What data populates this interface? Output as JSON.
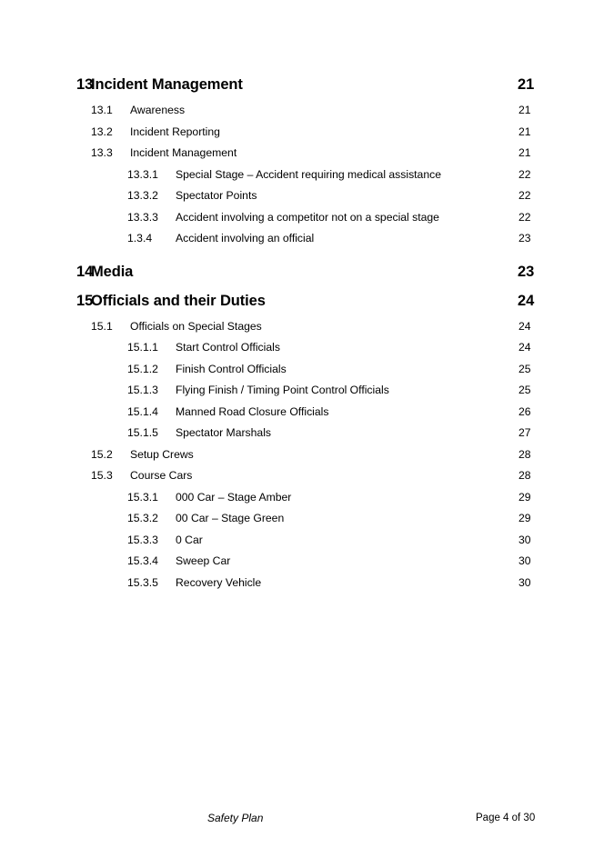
{
  "document": {
    "section_type": "table-of-contents"
  },
  "entries": [
    {
      "level": 1,
      "number": "13",
      "title": "Incident Management",
      "page": "21"
    },
    {
      "level": 2,
      "number": "13.1",
      "title": "Awareness",
      "page": "21"
    },
    {
      "level": 2,
      "number": "13.2",
      "title": "Incident Reporting",
      "page": "21"
    },
    {
      "level": 2,
      "number": "13.3",
      "title": "Incident Management",
      "page": "21"
    },
    {
      "level": 3,
      "number": "13.3.1",
      "title": "Special Stage – Accident requiring medical assistance",
      "page": "22"
    },
    {
      "level": 3,
      "number": "13.3.2",
      "title": "Spectator Points",
      "page": "22"
    },
    {
      "level": 3,
      "number": "13.3.3",
      "title": "Accident involving a competitor not on a special stage",
      "page": "22"
    },
    {
      "level": 3,
      "number": "1.3.4",
      "title": "Accident involving an official",
      "page": "23"
    },
    {
      "level": 1,
      "number": "14",
      "title": "Media",
      "page": "23"
    },
    {
      "level": 1,
      "number": "15",
      "title": "Officials and their Duties",
      "page": "24"
    },
    {
      "level": 2,
      "number": "15.1",
      "title": "Officials on Special Stages",
      "page": "24"
    },
    {
      "level": 3,
      "number": "15.1.1",
      "title": "Start Control Officials",
      "page": "24"
    },
    {
      "level": 3,
      "number": "15.1.2",
      "title": "Finish Control Officials",
      "page": "25"
    },
    {
      "level": 3,
      "number": "15.1.3",
      "title": "Flying Finish / Timing Point Control Officials",
      "page": "25"
    },
    {
      "level": 3,
      "number": "15.1.4",
      "title": "Manned Road Closure Officials",
      "page": "26"
    },
    {
      "level": 3,
      "number": "15.1.5",
      "title": "Spectator Marshals",
      "page": "27"
    },
    {
      "level": 2,
      "number": "15.2",
      "title": "Setup Crews",
      "page": "28"
    },
    {
      "level": 2,
      "number": "15.3",
      "title": "Course Cars",
      "page": "28"
    },
    {
      "level": 3,
      "number": "15.3.1",
      "title": "000 Car – Stage Amber",
      "page": "29"
    },
    {
      "level": 3,
      "number": "15.3.2",
      "title": "00 Car – Stage Green",
      "page": "29"
    },
    {
      "level": 3,
      "number": "15.3.3",
      "title": "0 Car",
      "page": "30"
    },
    {
      "level": 3,
      "number": "15.3.4",
      "title": "Sweep Car",
      "page": "30"
    },
    {
      "level": 3,
      "number": "15.3.5",
      "title": "Recovery Vehicle",
      "page": "30"
    }
  ],
  "footer": {
    "document_title": "Safety Plan",
    "page_indicator": "Page 4 of 30"
  }
}
